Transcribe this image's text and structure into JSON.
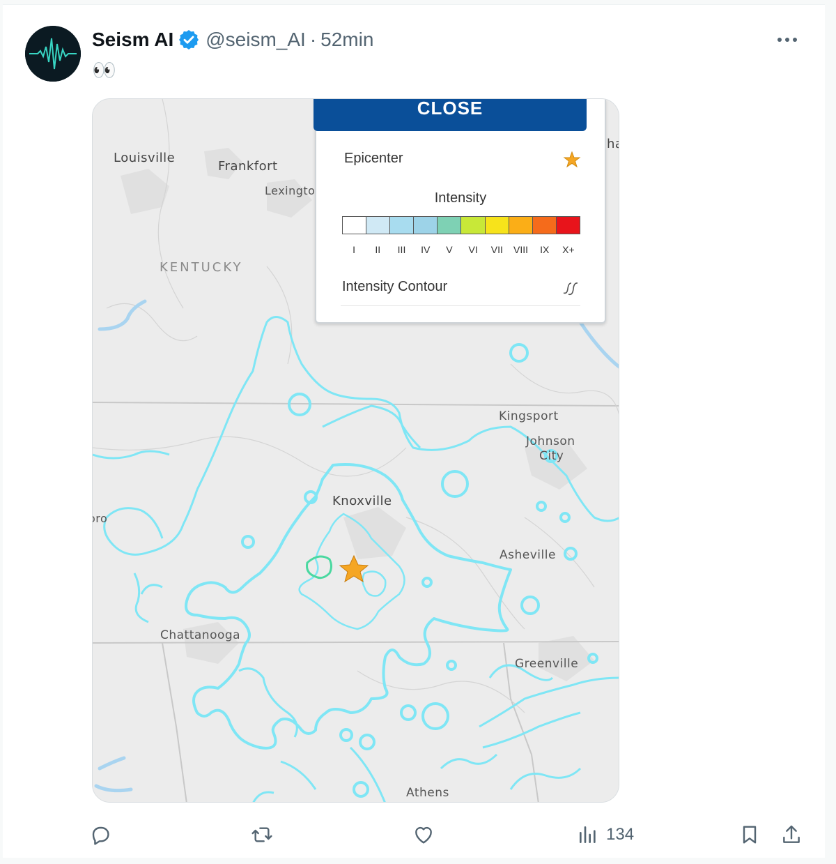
{
  "tweet": {
    "author_name": "Seism AI",
    "handle": "@seism_AI",
    "separator": "·",
    "time": "52min",
    "text": "👀",
    "accent_color": "#1d9bf0"
  },
  "map": {
    "labels": {
      "louisville": "Louisville",
      "frankfort": "Frankfort",
      "lexington": "Lexingto",
      "kentucky": "KENTUCKY",
      "ha": "ha",
      "kingsport": "Kingsport",
      "johnson_city_1": "Johnson",
      "johnson_city_2": "City",
      "knoxville": "Knoxville",
      "asheville": "Asheville",
      "ro": "oro",
      "chattanooga": "Chattanooga",
      "greenville": "Greenville",
      "athens": "Athens"
    },
    "contour_color": "#7fe6f5",
    "epicenter_color": "#f5a623"
  },
  "legend": {
    "close_label": "CLOSE",
    "epicenter_label": "Epicenter",
    "intensity_label": "Intensity",
    "contour_label": "Intensity Contour",
    "intensity_levels": [
      "I",
      "II",
      "III",
      "IV",
      "V",
      "VI",
      "VII",
      "VIII",
      "IX",
      "X+"
    ],
    "intensity_colors": [
      "#ffffff",
      "#d0e9f5",
      "#a8dcef",
      "#9dd3e8",
      "#7ed1b4",
      "#c8e838",
      "#f7e31b",
      "#fbae17",
      "#f56b1b",
      "#e8141b"
    ]
  },
  "actions": {
    "reply_count": "",
    "retweet_count": "",
    "like_count": "",
    "views_count": "134"
  }
}
